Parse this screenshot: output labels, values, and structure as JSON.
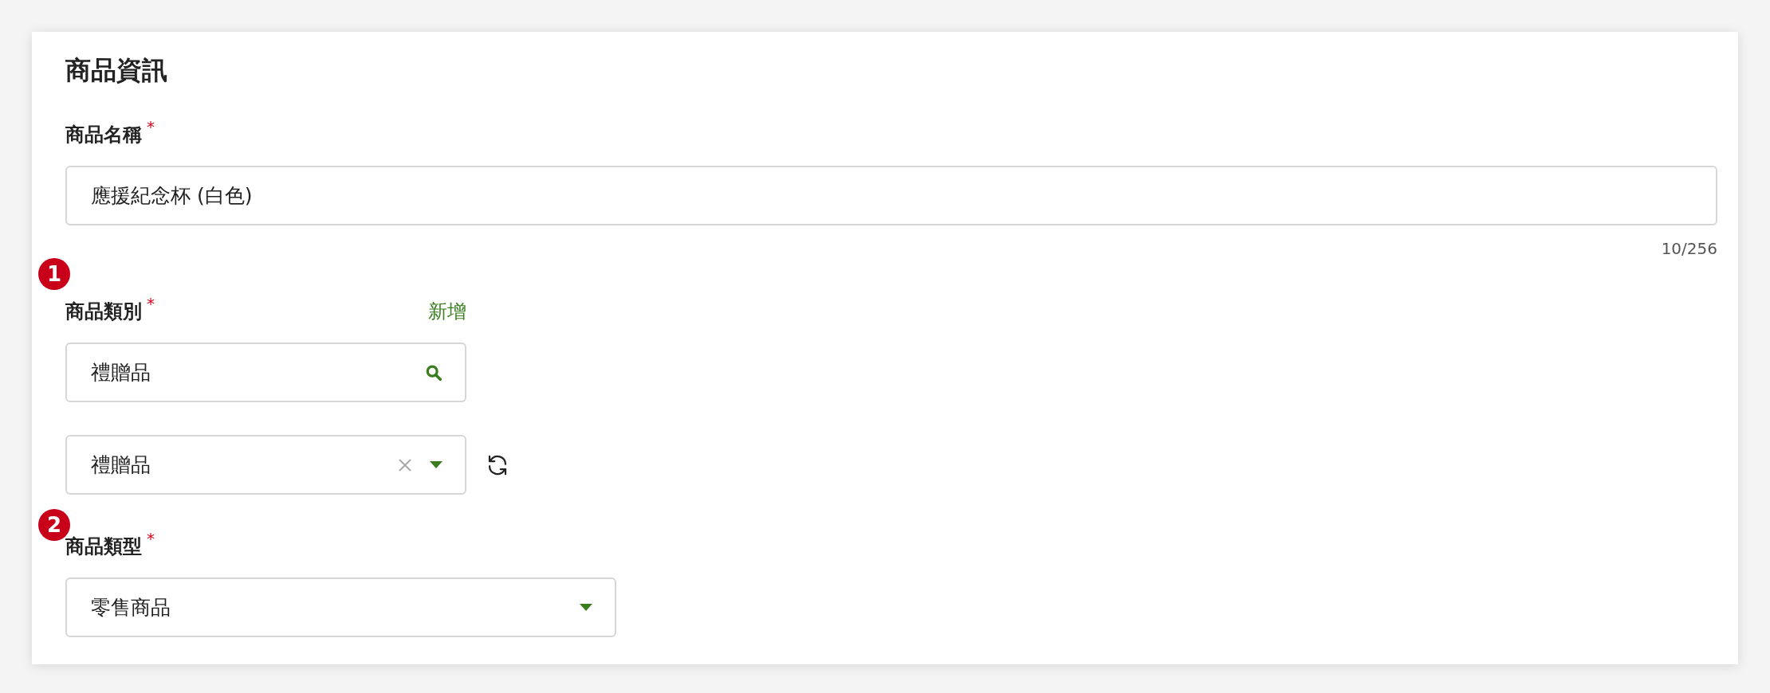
{
  "title": "商品資訊",
  "fields": [
    {
      "kind": "text",
      "label": "商品名稱",
      "required_mark": "*",
      "value": "應援紀念杯 (白色)",
      "counter": "10/256"
    },
    {
      "kind": "category",
      "marker": "1",
      "label": "商品類別",
      "required_mark": "*",
      "action": "新增",
      "search_value": "禮贈品",
      "select_value": "禮贈品"
    },
    {
      "kind": "select",
      "marker": "2",
      "label": "商品類型",
      "required_mark": "*",
      "value": "零售商品"
    }
  ]
}
